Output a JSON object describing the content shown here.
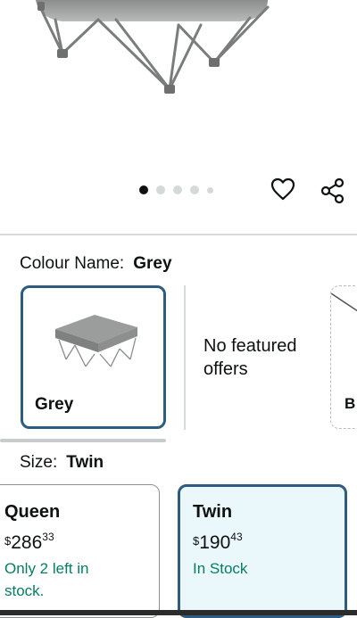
{
  "hero": {
    "dot_count": 5,
    "active_dot": 0,
    "wishlist_icon": "heart-icon",
    "share_icon": "share-icon"
  },
  "colour": {
    "label": "Colour Name:",
    "value": "Grey",
    "swatch_label": "Grey",
    "no_offers": "No featured offers",
    "next_label": "B"
  },
  "size": {
    "label": "Size:",
    "value": "Twin",
    "options": [
      {
        "name": "Queen",
        "currency": "$",
        "whole": "286",
        "fraction": "33",
        "stock": "Only 2 left in stock."
      },
      {
        "name": "Twin",
        "currency": "$",
        "whole": "190",
        "fraction": "43",
        "stock": "In Stock"
      }
    ]
  },
  "colors": {
    "selected_border": "#2f5b7f",
    "selected_bg": "#eaf7fb",
    "stock_green": "#067d62"
  }
}
